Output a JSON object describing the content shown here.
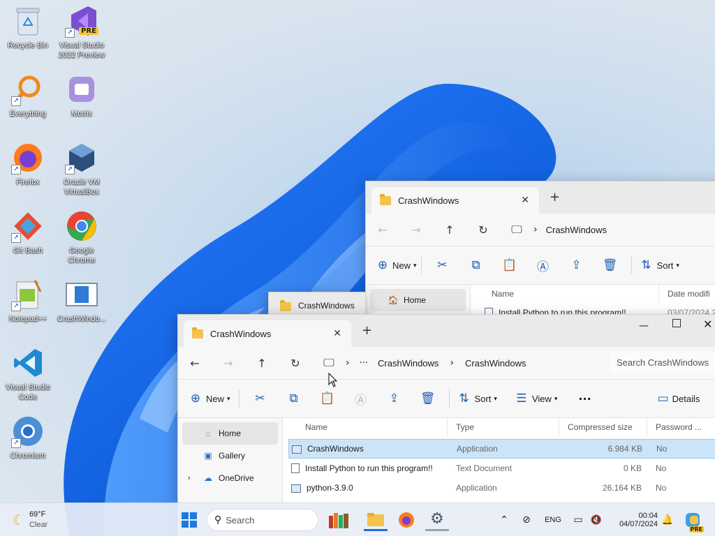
{
  "desktop": {
    "icons": [
      {
        "label": "Recycle Bin",
        "icon": "recycle-bin-icon"
      },
      {
        "label": "Visual Studio\n2022 Preview",
        "icon": "visual-studio-preview-icon",
        "badge": "PRE"
      },
      {
        "label": "Everything",
        "icon": "everything-search-icon"
      },
      {
        "label": "Motrix",
        "icon": "motrix-icon"
      },
      {
        "label": "Firefox",
        "icon": "firefox-icon"
      },
      {
        "label": "Oracle VM\nVirtualBox",
        "icon": "virtualbox-icon"
      },
      {
        "label": "Git Bash",
        "icon": "git-bash-icon"
      },
      {
        "label": "Google\nChrome",
        "icon": "chrome-icon"
      },
      {
        "label": "Notepad++",
        "icon": "notepadpp-icon"
      },
      {
        "label": "CrashWindo...",
        "icon": "crashwindows-app-icon"
      },
      {
        "label": "Visual Studio\nCode",
        "icon": "vscode-icon"
      },
      {
        "label": "Chromium",
        "icon": "chromium-icon"
      }
    ]
  },
  "back_window": {
    "tab_title": "CrashWindows",
    "tab_close": "✕",
    "new_tab": "+",
    "breadcrumb": "CrashWindows",
    "new_label": "New",
    "sort_label": "Sort",
    "nav_home": "Home",
    "col_name": "Name",
    "col_date": "Date modifi",
    "row_name": "Install Python to run this program!!",
    "row_date": "03/07/2024 2"
  },
  "mid_window": {
    "tab_title": "CrashWindows"
  },
  "front_window": {
    "tab_title": "CrashWindows",
    "tab_close": "✕",
    "new_tab": "+",
    "breadcrumb": [
      "CrashWindows",
      "CrashWindows"
    ],
    "search_placeholder": "Search CrashWindows",
    "toolbar": {
      "new_label": "New",
      "sort_label": "Sort",
      "view_label": "View",
      "details_label": "Details"
    },
    "nav": [
      {
        "label": "Home",
        "selected": true
      },
      {
        "label": "Gallery",
        "selected": false
      },
      {
        "label": "OneDrive",
        "selected": false
      }
    ],
    "columns": [
      "Name",
      "Type",
      "Compressed size",
      "Password ..."
    ],
    "files": [
      {
        "name": "CrashWindows",
        "type": "Application",
        "size": "6.984 KB",
        "password": "No",
        "kind": "app",
        "selected": true
      },
      {
        "name": "Install Python to run this program!!",
        "type": "Text Document",
        "size": "0 KB",
        "password": "No",
        "kind": "text",
        "selected": false
      },
      {
        "name": "python-3.9.0",
        "type": "Application",
        "size": "26.164 KB",
        "password": "No",
        "kind": "app",
        "selected": false
      }
    ]
  },
  "taskbar": {
    "weather_temp": "69°F",
    "weather_desc": "Clear",
    "search_placeholder": "Search",
    "lang": "ENG",
    "time": "00:04",
    "date": "04/07/2024",
    "tray_badge": "PRE"
  },
  "colors": {
    "accent": "#1f5fb0",
    "selection": "#cce4f7",
    "folder": "#f3c34b"
  }
}
